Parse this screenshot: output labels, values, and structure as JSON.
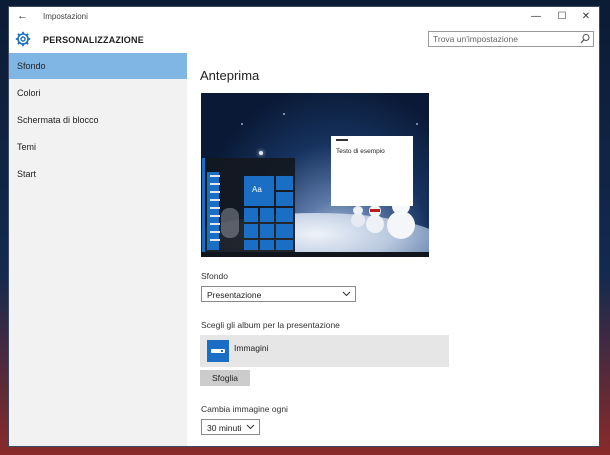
{
  "window": {
    "title": "Impostazioni",
    "back_glyph": "←",
    "minimize_glyph": "—",
    "maximize_glyph": "☐",
    "close_glyph": "✕"
  },
  "header": {
    "app_title": "PERSONALIZZAZIONE",
    "search_placeholder": "Trova un'impostazione"
  },
  "sidebar": {
    "items": [
      {
        "label": "Sfondo",
        "selected": true
      },
      {
        "label": "Colori",
        "selected": false
      },
      {
        "label": "Schermata di blocco",
        "selected": false
      },
      {
        "label": "Temi",
        "selected": false
      },
      {
        "label": "Start",
        "selected": false
      }
    ]
  },
  "main": {
    "heading": "Anteprima",
    "preview": {
      "sample_text": "Testo di esempio",
      "tile_text": "Aa"
    },
    "background": {
      "label": "Sfondo",
      "value": "Presentazione"
    },
    "album": {
      "label": "Scegli gli album per la presentazione",
      "name": "Immagini",
      "browse_label": "Sfoglia"
    },
    "interval": {
      "label": "Cambia immagine ogni",
      "value": "30 minuti"
    }
  },
  "colors": {
    "accent": "#1a6fc4",
    "selected_nav": "#7fb6e3",
    "sidebar_bg": "#f2f2f2"
  },
  "icons": [
    "back-arrow-icon",
    "gear-icon",
    "search-icon",
    "chevron-down-icon",
    "album-folder-icon"
  ]
}
